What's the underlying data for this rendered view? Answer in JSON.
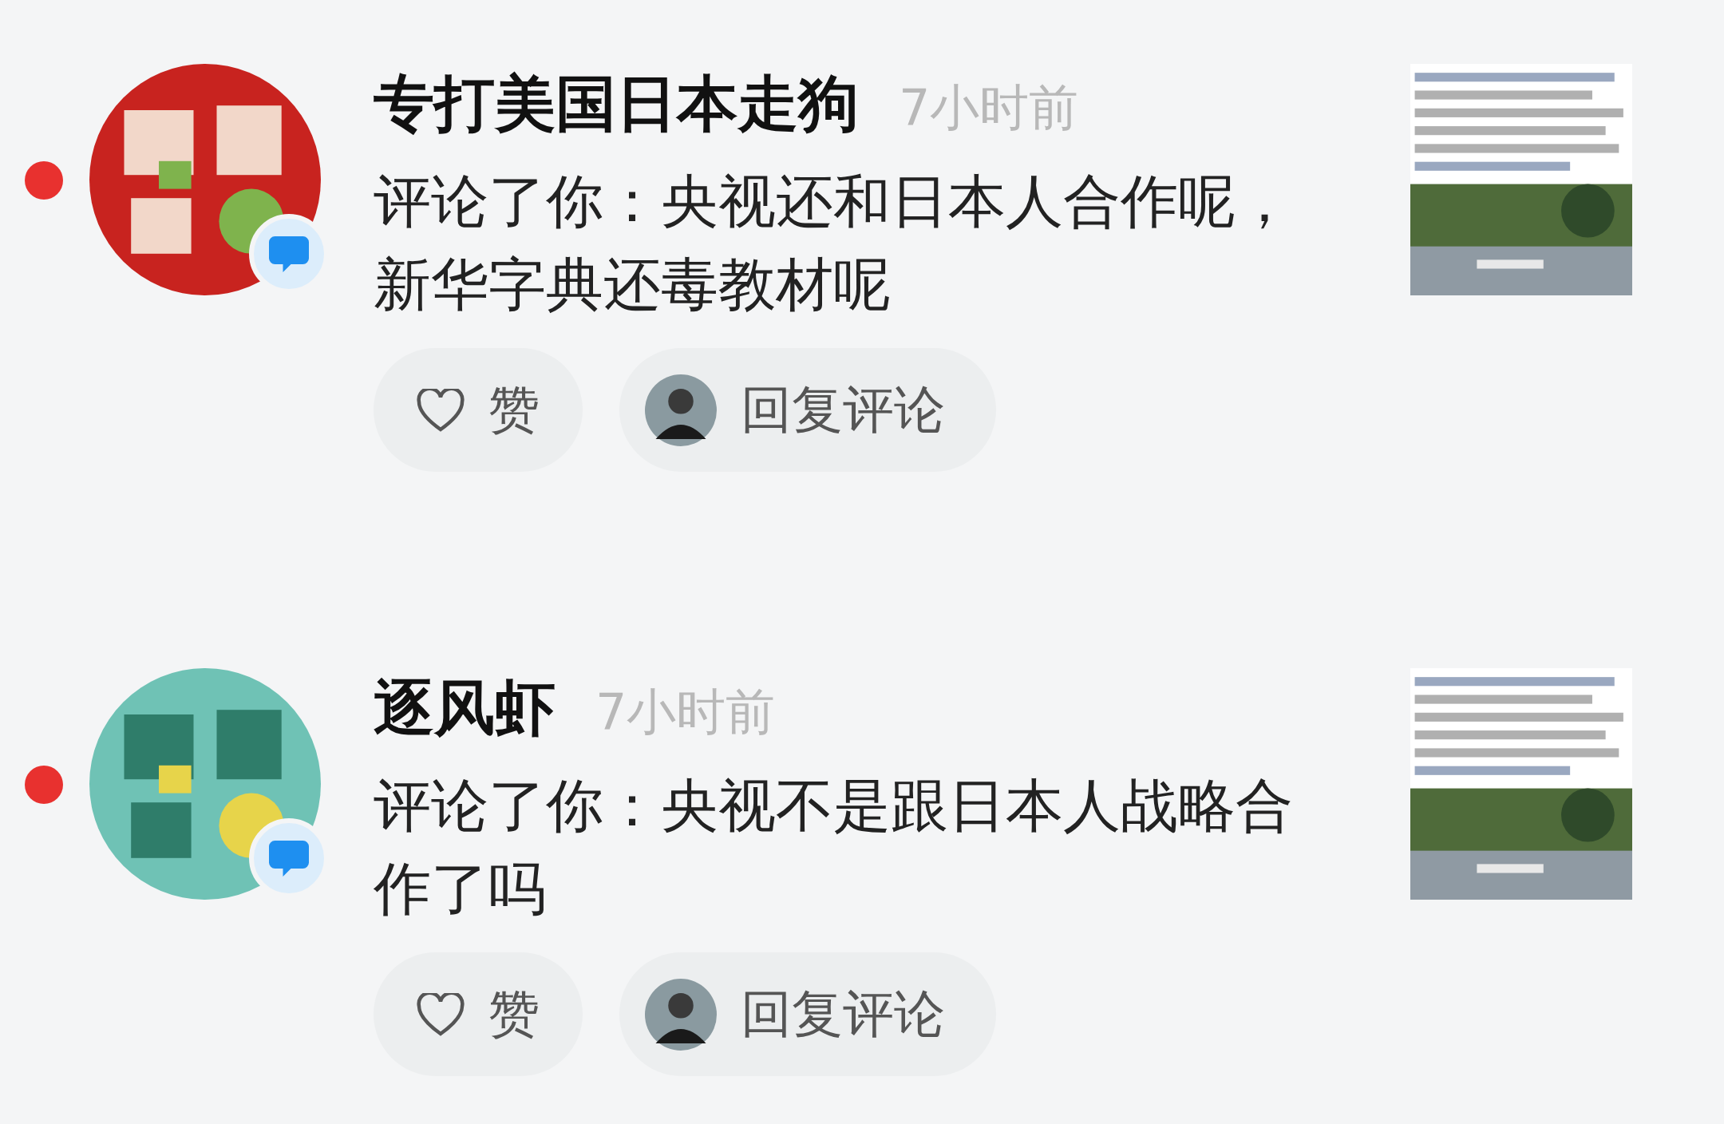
{
  "notifications": [
    {
      "unread": true,
      "name": "专打美国日本走狗",
      "time": "7小时前",
      "comment": "评论了你：央视还和日本人合作呢，新华字典还毒教材呢",
      "like_label": "赞",
      "reply_label": "回复评论"
    },
    {
      "unread": true,
      "name": "逐风虾",
      "time": "7小时前",
      "comment": "评论了你：央视不是跟日本人战略合作了吗",
      "like_label": "赞",
      "reply_label": "回复评论"
    }
  ]
}
